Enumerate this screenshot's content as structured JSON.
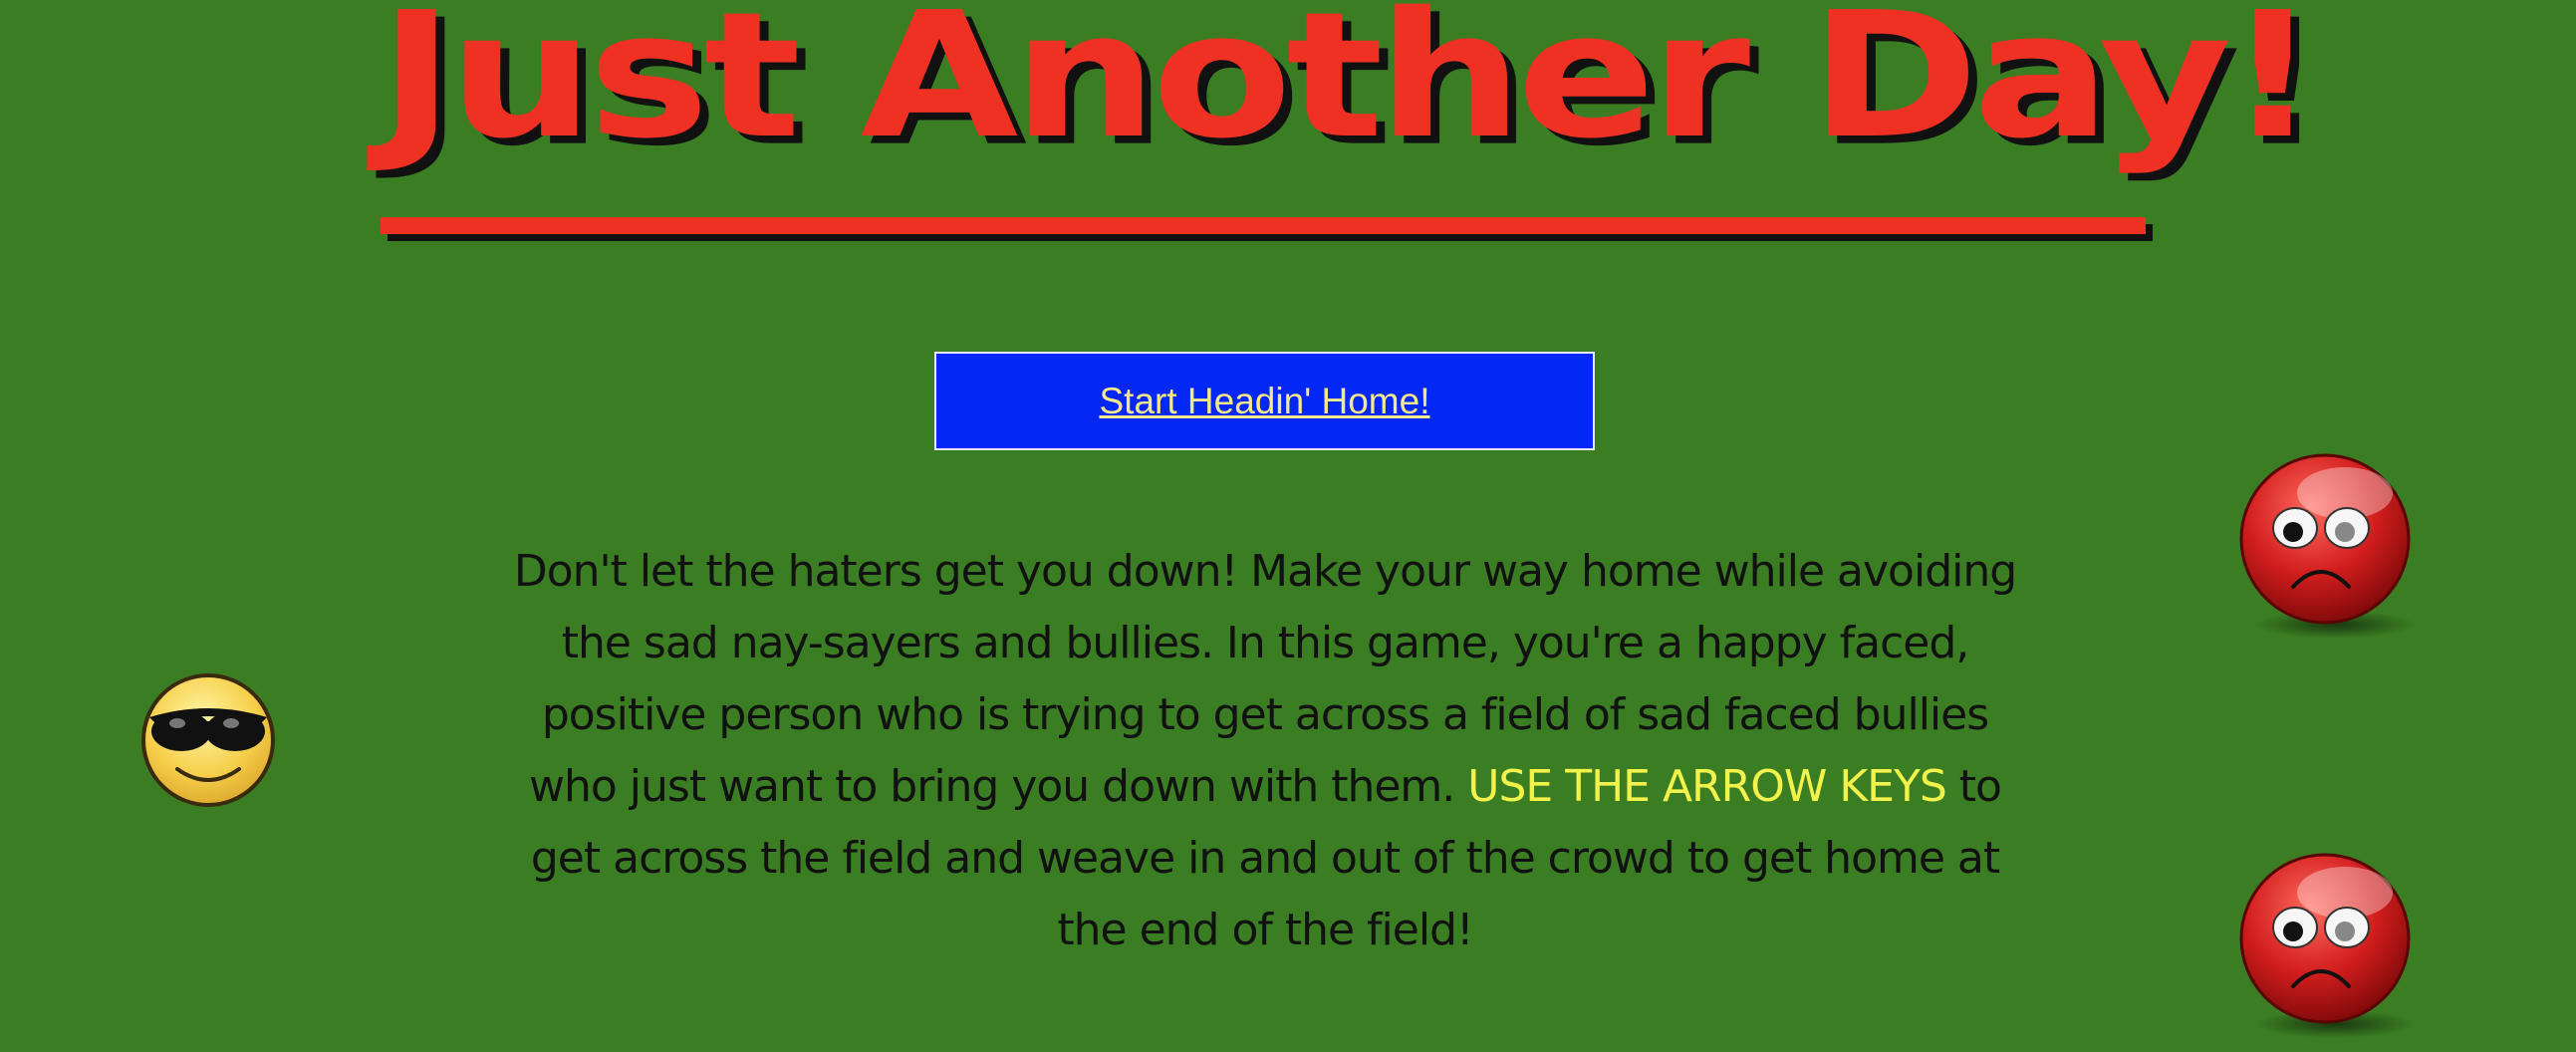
{
  "header": {
    "title": "Just Another Day!"
  },
  "start_button": {
    "label": "Start Headin' Home!"
  },
  "instructions": {
    "text_before": "Don't let the haters get you down! Make your way home while avoiding the sad nay-sayers and bullies. In this game, you're a happy faced, positive person who is trying to get across a field of sad faced bullies who just want to bring you down with them. ",
    "highlight": "USE THE ARROW KEYS",
    "text_after": " to get across the field and weave in and out of the crowd to get home at the end of the field!"
  },
  "sprites": {
    "player": "sunglasses-smiley-icon",
    "enemy": "sad-face-icon"
  },
  "colors": {
    "background": "#3a7d22",
    "title": "#ef3124",
    "button": "#0328f5",
    "button_text": "#f4e88a",
    "highlight": "#f2f24a"
  }
}
